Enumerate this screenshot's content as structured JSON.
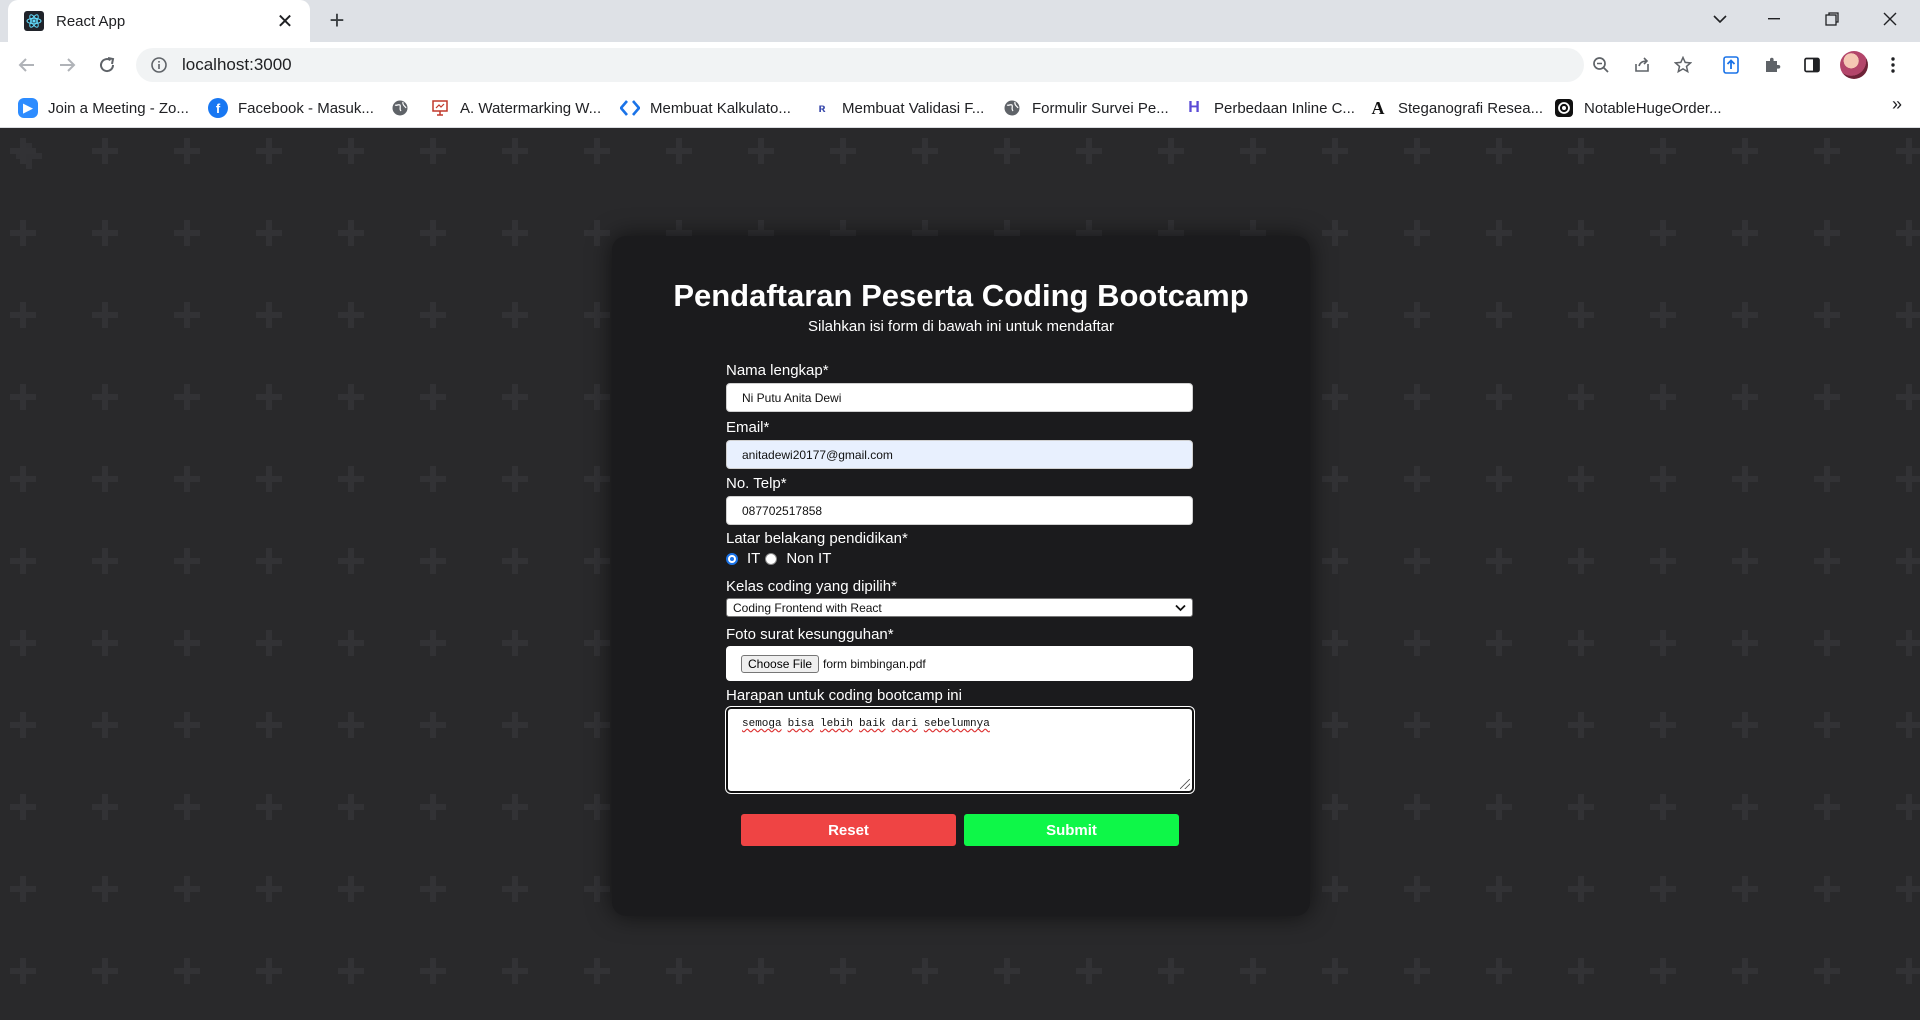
{
  "browser": {
    "tab_title": "React App",
    "url": "localhost:3000",
    "bookmarks": [
      {
        "label": "Join a Meeting - Zo...",
        "icon": "zoom-icon",
        "color": "#2d8cff"
      },
      {
        "label": "Facebook - Masuk...",
        "icon": "facebook-icon",
        "color": "#1877f2"
      },
      {
        "label": "",
        "icon": "globe-icon",
        "color": "#5f6368"
      },
      {
        "label": "A. Watermarking W...",
        "icon": "slides-icon",
        "color": "#c0392b"
      },
      {
        "label": "Membuat Kalkulato...",
        "icon": "code-icon",
        "color": "#1a73e8"
      },
      {
        "label": "Membuat Validasi F...",
        "icon": "r-icon",
        "color": "#3949ab"
      },
      {
        "label": "Formulir Survei Pe...",
        "icon": "globe-icon",
        "color": "#5f6368"
      },
      {
        "label": "Perbedaan Inline C...",
        "icon": "h-icon",
        "color": "#5b4bd6"
      },
      {
        "label": "Steganografi Resea...",
        "icon": "a-icon",
        "color": "#111111"
      },
      {
        "label": "NotableHugeOrder...",
        "icon": "replit-icon",
        "color": "#111111"
      }
    ]
  },
  "form": {
    "title": "Pendaftaran Peserta Coding Bootcamp",
    "subtitle": "Silahkan isi form di bawah ini untuk mendaftar",
    "name_label": "Nama lengkap*",
    "name_value": "Ni Putu Anita Dewi",
    "email_label": "Email*",
    "email_value": "anitadewi20177@gmail.com",
    "phone_label": "No. Telp*",
    "phone_value": "087702517858",
    "education_label": "Latar belakang pendidikan*",
    "education_options": [
      "IT",
      "Non IT"
    ],
    "education_selected": "IT",
    "class_label": "Kelas coding yang dipilih*",
    "class_value": "Coding Frontend with React",
    "file_label": "Foto surat kesungguhan*",
    "file_button": "Choose File",
    "file_name": "form bimbingan.pdf",
    "hope_label": "Harapan untuk coding bootcamp ini",
    "hope_words": [
      "semoga",
      "bisa",
      "lebih",
      "baik",
      "dari",
      "sebelumnya"
    ],
    "reset_label": "Reset",
    "submit_label": "Submit"
  },
  "colors": {
    "card_bg": "#1b1b1d",
    "page_bg": "#29292b",
    "reset": "#ef4444",
    "submit": "#0ef748"
  }
}
